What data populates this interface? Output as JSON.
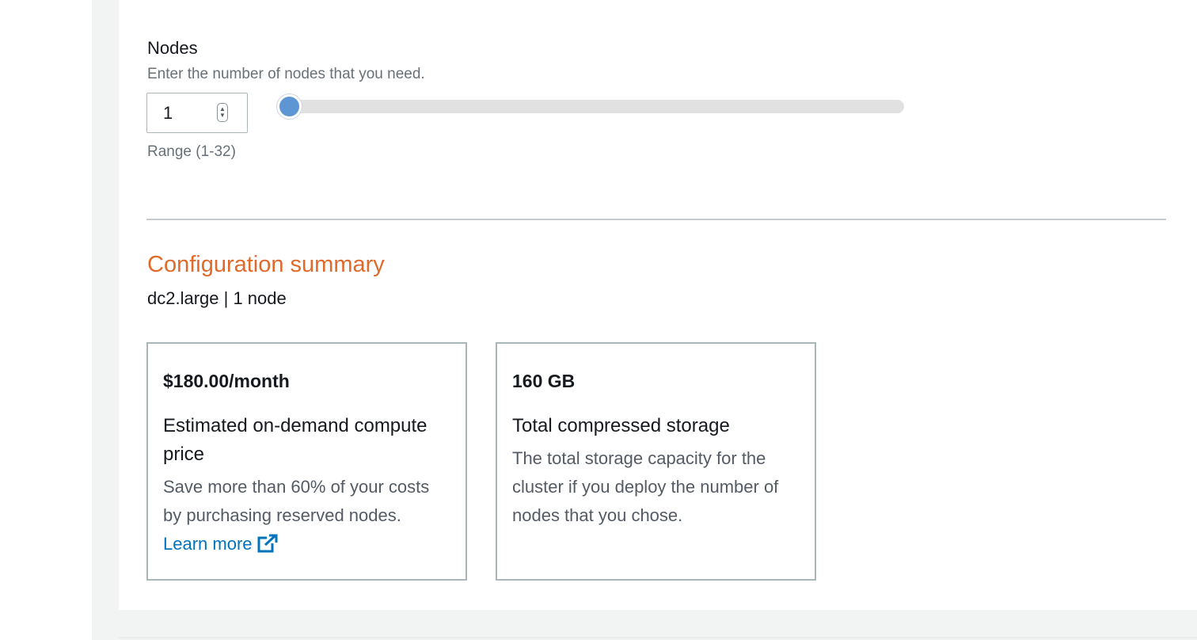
{
  "nodes": {
    "label": "Nodes",
    "description": "Enter the number of nodes that you need.",
    "value": "1",
    "range_text": "Range (1-32)",
    "slider": {
      "min": 1,
      "max": 32,
      "value": 1
    }
  },
  "summary": {
    "title": "Configuration summary",
    "subtitle": "dc2.large | 1 node",
    "cards": [
      {
        "value": "$180.00/month",
        "heading": "Estimated on-demand compute price",
        "body": "Save more than 60% of your costs by purchasing reserved nodes.",
        "link_label": "Learn more",
        "link_icon": "external-link-icon"
      },
      {
        "value": "160 GB",
        "heading": "Total compressed storage",
        "body": "The total storage capacity for the cluster if you deploy the number of nodes that you chose."
      }
    ]
  },
  "colors": {
    "accent_orange": "#e06a2c",
    "link_blue": "#0073bb",
    "slider_handle": "#5e96d3"
  }
}
